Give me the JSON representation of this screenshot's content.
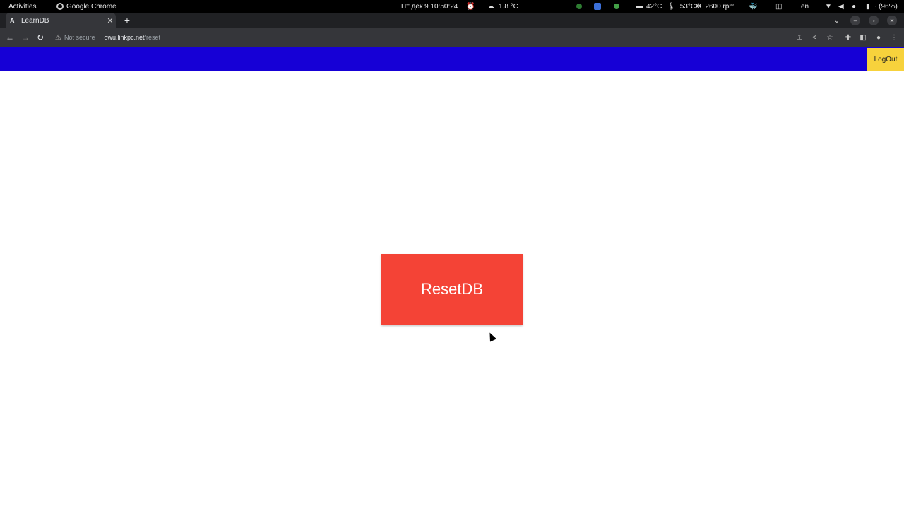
{
  "os_bar": {
    "activities": "Activities",
    "app_name": "Google Chrome",
    "datetime": "Пт дек 9  10:50:24",
    "weather": "1.8 °C",
    "cpu_temp": "42°C",
    "gpu_temp": "53°C",
    "fan": "2600 rpm",
    "lang": "en",
    "battery": "~ (96%)"
  },
  "browser": {
    "tab_title": "LearnDB",
    "tab_favicon": "A",
    "url_warning": "Not secure",
    "url_host": "owu.linkpc.net",
    "url_path": "/reset"
  },
  "page": {
    "logout_label": "LogOut",
    "reset_label": "ResetDB",
    "colors": {
      "appbar": "#1600d6",
      "logout": "#f7d23c",
      "reset": "#f44336"
    }
  }
}
